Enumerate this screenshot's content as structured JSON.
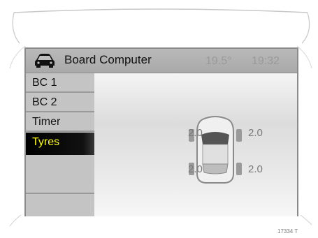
{
  "header": {
    "icon": "car-icon",
    "title": "Board Computer",
    "temperature": "19.5°",
    "time": "19:32"
  },
  "menu": {
    "items": [
      {
        "label": "BC 1"
      },
      {
        "label": "BC 2"
      },
      {
        "label": "Timer"
      },
      {
        "label": "Tyres"
      },
      {
        "label": ""
      },
      {
        "label": ""
      }
    ],
    "selected": "Tyres"
  },
  "tyres": {
    "front_left": "2.0",
    "front_right": "2.0",
    "rear_left": "2.0",
    "rear_right": "2.0"
  },
  "colors": {
    "selected_text": "#ffff00",
    "selected_bg": "#000000"
  },
  "reference": "17334 T"
}
